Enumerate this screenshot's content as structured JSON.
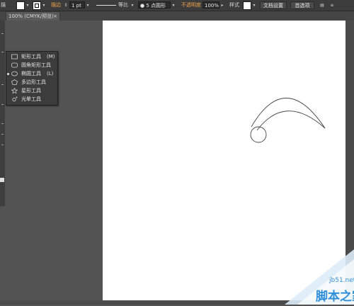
{
  "control_bar": {
    "leading_label": "描",
    "stroke_label": "描边",
    "stroke_weight": "1 pt",
    "stroke_profile": "等比",
    "brush_label": "5 点圆形",
    "opacity_label": "不透明度",
    "opacity_value": "100%",
    "style_label": "样式",
    "doc_setup_button": "文档设置",
    "preferences_button": "首选项"
  },
  "document_tab": {
    "label": "100% (CMYK/预览)",
    "close": "×"
  },
  "shape_flyout": {
    "items": [
      {
        "label": "矩形工具",
        "shortcut": "(M)",
        "icon": "rectangle-icon"
      },
      {
        "label": "圆角矩形工具",
        "shortcut": "",
        "icon": "rounded-rectangle-icon"
      },
      {
        "label": "椭圆工具",
        "shortcut": "(L)",
        "icon": "ellipse-icon",
        "selected": true
      },
      {
        "label": "多边形工具",
        "shortcut": "",
        "icon": "polygon-icon"
      },
      {
        "label": "星形工具",
        "shortcut": "",
        "icon": "star-icon"
      },
      {
        "label": "光晕工具",
        "shortcut": "",
        "icon": "flare-icon"
      }
    ]
  },
  "watermark": {
    "domain": "jb51.net",
    "brand": "脚本之家"
  },
  "colors": {
    "ui_dark": "#535353",
    "artboard": "#ffffff",
    "accent_orange": "#f0a24a",
    "watermark_blue": "#2f8fd8"
  }
}
